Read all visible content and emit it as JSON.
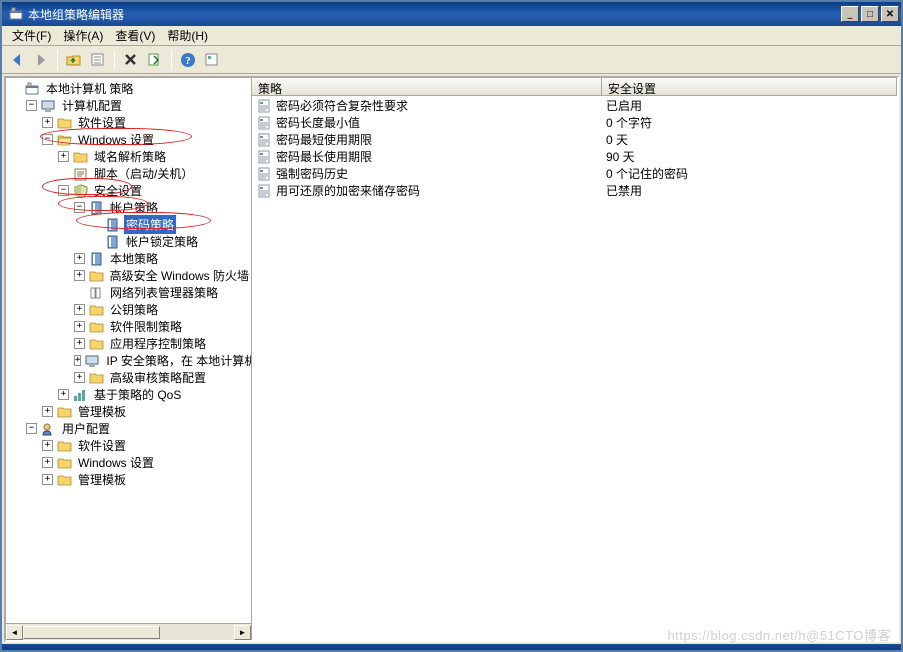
{
  "title": "本地组策略编辑器",
  "menu": {
    "file": "文件(F)",
    "action": "操作(A)",
    "view": "查看(V)",
    "help": "帮助(H)"
  },
  "tree": {
    "root": "本地计算机 策略",
    "computerConfig": "计算机配置",
    "softwareSettings": "软件设置",
    "windowsSettings": "Windows 设置",
    "dnsPolicy": "域名解析策略",
    "scripts": "脚本（启动/关机）",
    "security": "安全设置",
    "account": "帐户策略",
    "password": "密码策略",
    "lockout": "帐户锁定策略",
    "localPolicy": "本地策略",
    "advFirewall": "高级安全 Windows 防火墙",
    "nlm": "网络列表管理器策略",
    "pki": "公钥策略",
    "srp": "软件限制策略",
    "appctrl": "应用程序控制策略",
    "ipsec": "IP 安全策略，在 本地计算机",
    "audit": "高级审核策略配置",
    "qos": "基于策略的 QoS",
    "admTpl": "管理模板",
    "userConfig": "用户配置",
    "uSoft": "软件设置",
    "uWin": "Windows 设置",
    "uAdm": "管理模板"
  },
  "columns": {
    "policy": "策略",
    "setting": "安全设置"
  },
  "policies": [
    {
      "name": "密码必须符合复杂性要求",
      "value": "已启用"
    },
    {
      "name": "密码长度最小值",
      "value": "0 个字符"
    },
    {
      "name": "密码最短使用期限",
      "value": "0 天"
    },
    {
      "name": "密码最长使用期限",
      "value": "90 天"
    },
    {
      "name": "强制密码历史",
      "value": "0 个记住的密码"
    },
    {
      "name": "用可还原的加密来储存密码",
      "value": "已禁用"
    }
  ],
  "watermark": "https://blog.csdn.net/h@51CTO博客"
}
